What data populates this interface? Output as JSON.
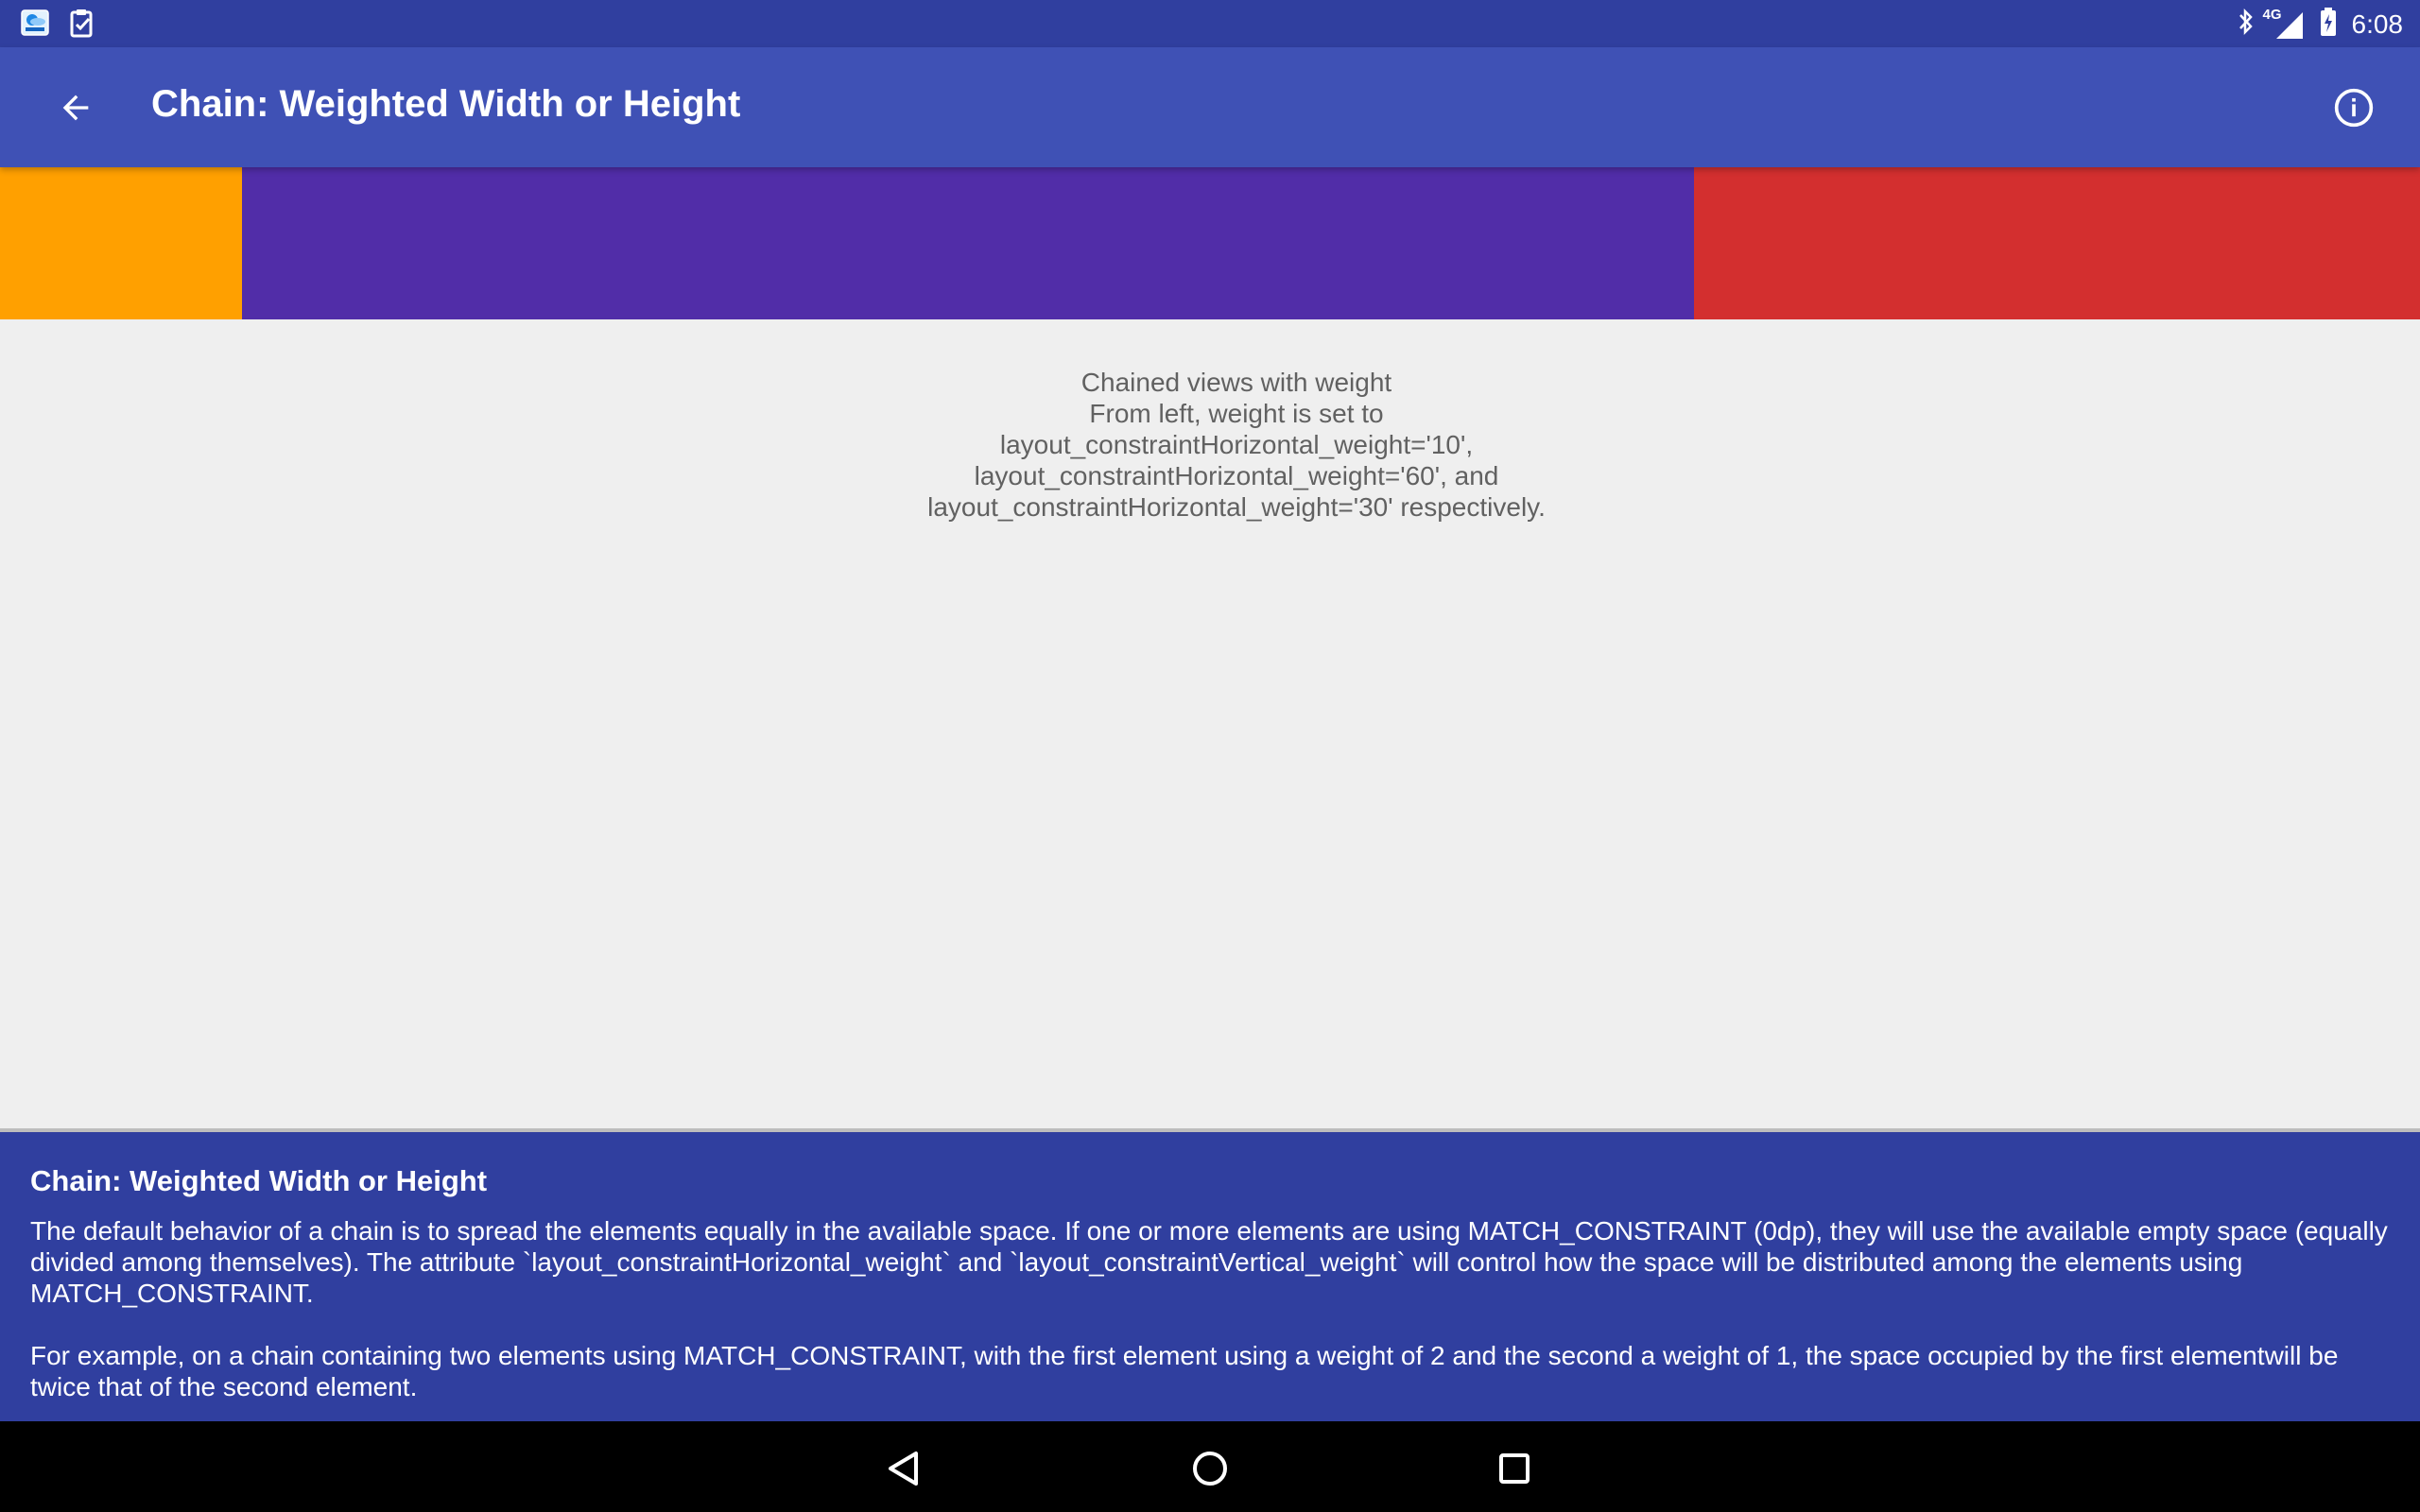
{
  "status_bar": {
    "time": "6:08",
    "network": "4G",
    "left_icons": [
      "weather-app-icon",
      "task-check-icon"
    ],
    "right_icons": [
      "bluetooth-icon",
      "signal-icon",
      "battery-charging-icon"
    ]
  },
  "app_bar": {
    "back_icon": "arrow-back-icon",
    "title": "Chain: Weighted Width or Height",
    "info_icon": "info-icon"
  },
  "chain": {
    "boxes": [
      {
        "name": "orange",
        "color": "#ffa000",
        "weight": 10
      },
      {
        "name": "purple",
        "color": "#512da8",
        "weight": 60
      },
      {
        "name": "red",
        "color": "#d32f2f",
        "weight": 30
      }
    ],
    "caption_lines": [
      "Chained views with weight",
      "From left, weight is set to",
      "layout_constraintHorizontal_weight='10',",
      "layout_constraintHorizontal_weight='60', and",
      "layout_constraintHorizontal_weight='30' respectively."
    ]
  },
  "description": {
    "title": "Chain: Weighted Width or Height",
    "paragraph1": "The default behavior of a chain is to spread the elements equally in the available space. If one or more elements are using MATCH_CONSTRAINT (0dp), they will use the available empty space (equally divided among themselves). The attribute `layout_constraintHorizontal_weight` and `layout_constraintVertical_weight` will control how the space will be distributed among the elements using MATCH_CONSTRAINT.",
    "paragraph2": "For example, on a chain containing two elements using MATCH_CONSTRAINT, with the first element using a weight of 2 and the second a weight of 1, the space occupied by the first elementwill be twice that of the second element."
  },
  "nav_bar": {
    "buttons": [
      "back-triangle-icon",
      "home-circle-icon",
      "recents-square-icon"
    ]
  }
}
